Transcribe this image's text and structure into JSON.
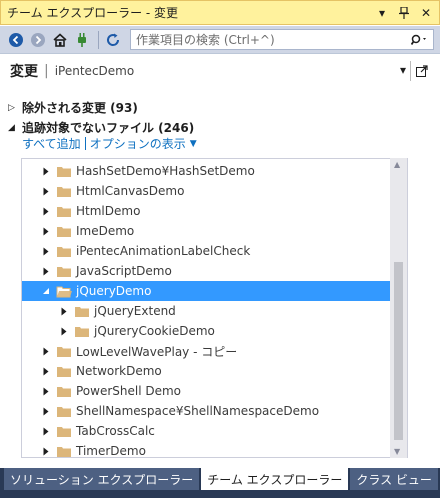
{
  "titlebar": {
    "title": "チーム エクスプローラー - 変更",
    "dropdown_glyph": "▾",
    "pin_glyph": "⊥",
    "close_glyph": "✕"
  },
  "toolbar": {
    "search_placeholder": "作業項目の検索 (Ctrl+^)",
    "search_glyph": "🔍▾"
  },
  "page_header": {
    "title": "変更",
    "separator": "|",
    "subtitle": "iPentecDemo",
    "dropdown_glyph": "▾"
  },
  "sections": {
    "excluded": {
      "arrow": "▷",
      "label": "除外される変更 (93)"
    },
    "untracked": {
      "arrow": "◢",
      "label": "追跡対象でないファイル (246)"
    },
    "actions": {
      "add_all": "すべて追加",
      "view_options": "オプションの表示",
      "caret": "▼"
    }
  },
  "tree": {
    "rows": [
      {
        "label": "HashSetDemo¥HashSetDemo",
        "level": 0,
        "expanded": false,
        "selected": false
      },
      {
        "label": "HtmlCanvasDemo",
        "level": 0,
        "expanded": false,
        "selected": false
      },
      {
        "label": "HtmlDemo",
        "level": 0,
        "expanded": false,
        "selected": false
      },
      {
        "label": "ImeDemo",
        "level": 0,
        "expanded": false,
        "selected": false
      },
      {
        "label": "iPentecAnimationLabelCheck",
        "level": 0,
        "expanded": false,
        "selected": false
      },
      {
        "label": "JavaScriptDemo",
        "level": 0,
        "expanded": false,
        "selected": false
      },
      {
        "label": "jQueryDemo",
        "level": 0,
        "expanded": true,
        "selected": true
      },
      {
        "label": "jQueryExtend",
        "level": 1,
        "expanded": false,
        "selected": false
      },
      {
        "label": "jQureryCookieDemo",
        "level": 1,
        "expanded": false,
        "selected": false
      },
      {
        "label": "LowLevelWavePlay - コピー",
        "level": 0,
        "expanded": false,
        "selected": false
      },
      {
        "label": "NetworkDemo",
        "level": 0,
        "expanded": false,
        "selected": false
      },
      {
        "label": "PowerShell Demo",
        "level": 0,
        "expanded": false,
        "selected": false
      },
      {
        "label": "ShellNamespace¥ShellNamespaceDemo",
        "level": 0,
        "expanded": false,
        "selected": false
      },
      {
        "label": "TabCrossCalc",
        "level": 0,
        "expanded": false,
        "selected": false
      },
      {
        "label": "TimerDemo",
        "level": 0,
        "expanded": false,
        "selected": false
      }
    ]
  },
  "tabs": [
    {
      "label": "ソリューション エクスプローラー",
      "active": false
    },
    {
      "label": "チーム エクスプローラー",
      "active": true
    },
    {
      "label": "クラス ビュー",
      "active": false
    }
  ],
  "colors": {
    "folder": "#dcb67a",
    "selection": "#3399ff",
    "link": "#0e70c0",
    "titlebar": "#fff29d"
  }
}
